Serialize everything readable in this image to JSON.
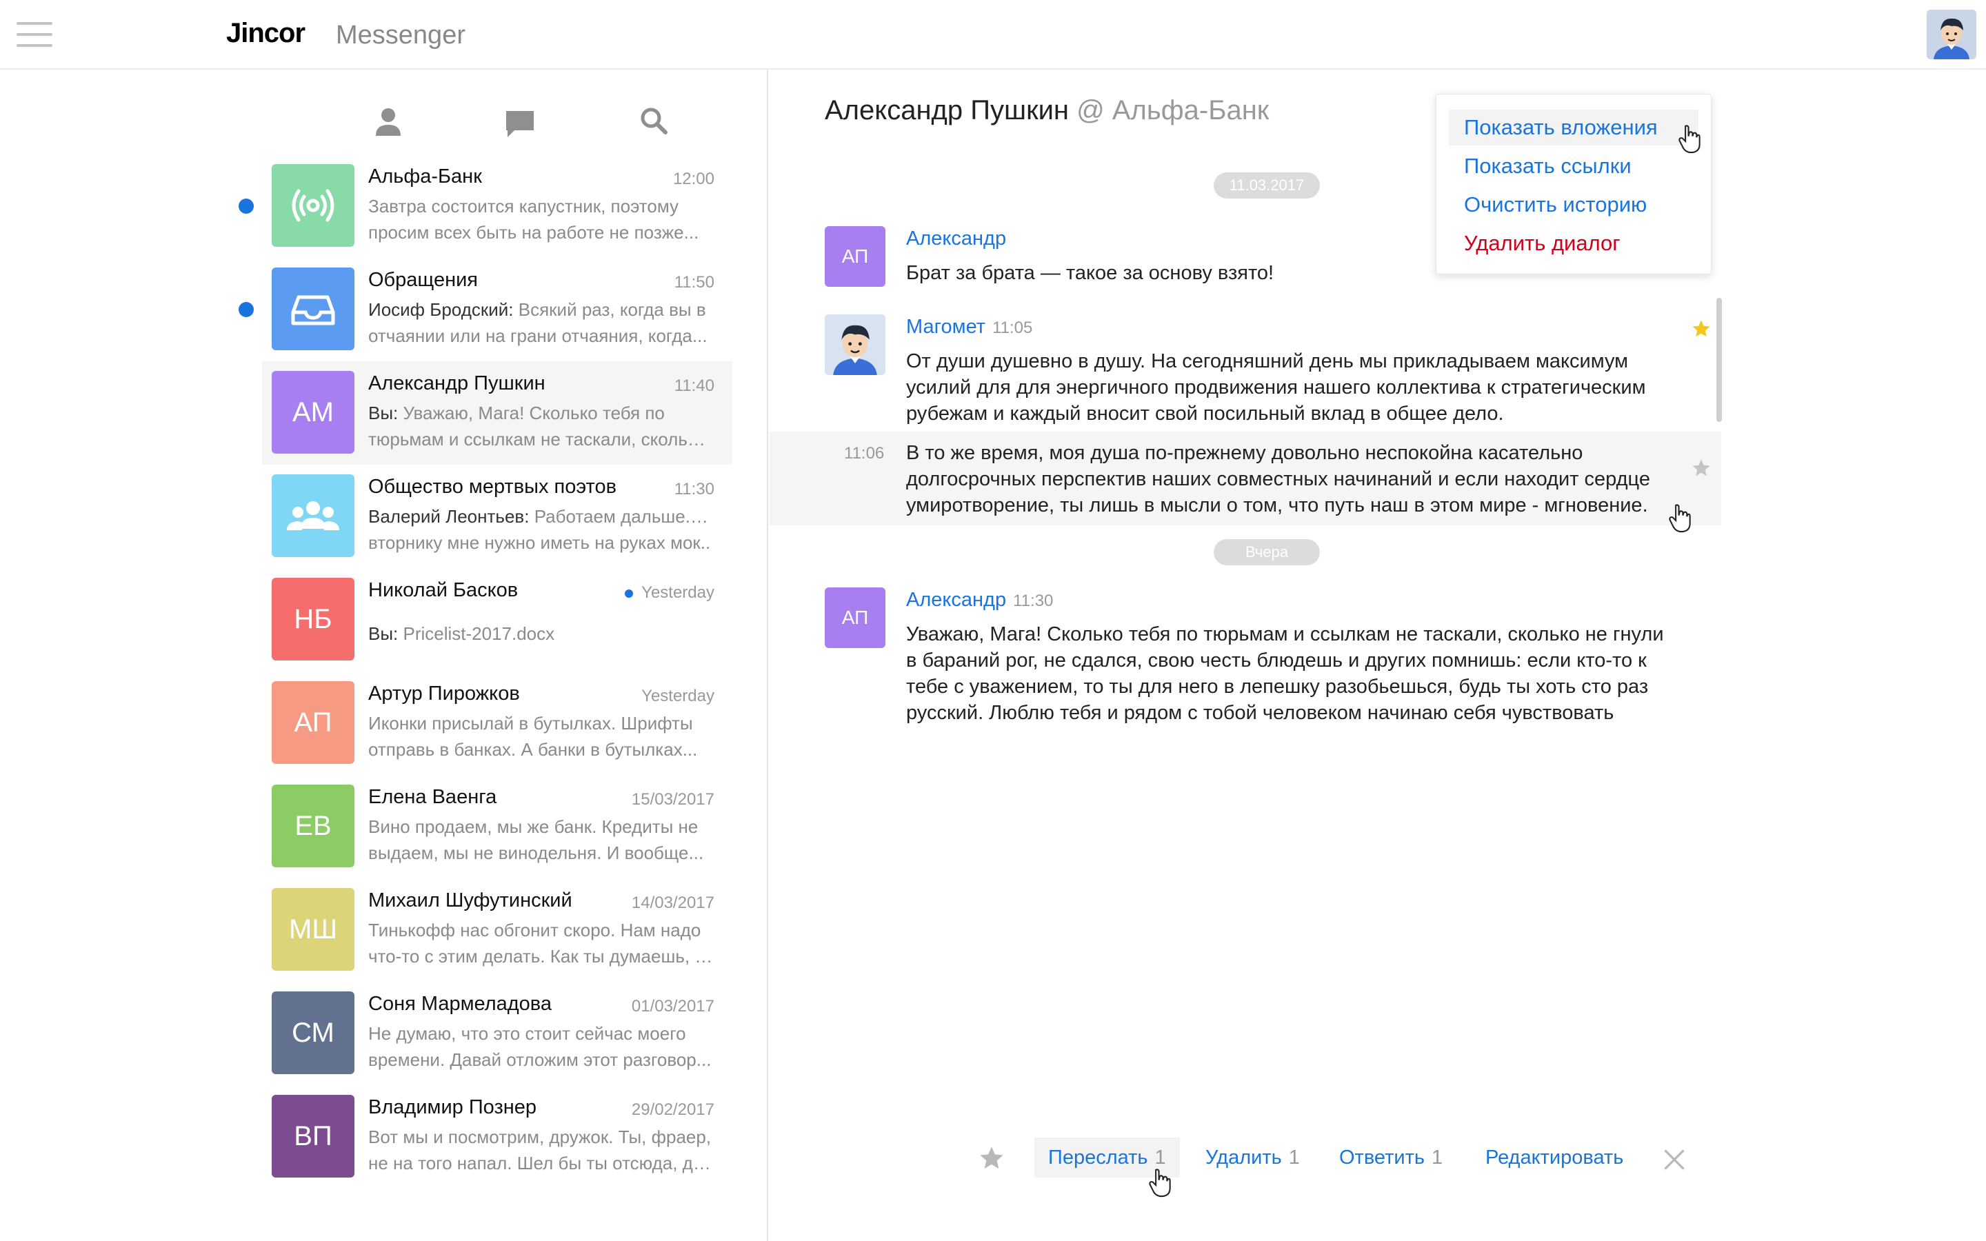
{
  "header": {
    "logo": "Jincor",
    "app_name": "Messenger"
  },
  "sidebar": {
    "tabs": [
      {
        "icon": "person-icon"
      },
      {
        "icon": "chat-bubble-icon"
      },
      {
        "icon": "search-icon"
      }
    ],
    "contacts": [
      {
        "name": "Альфа-Банк",
        "time": "12:00",
        "unread": true,
        "avatar_icon": "broadcast-icon",
        "avatar_color": "#88dba9",
        "sender": "",
        "preview": [
          "Завтра состоится капустник, поэтому",
          "просим всех быть на работе не позже..."
        ]
      },
      {
        "name": "Обращения",
        "time": "11:50",
        "unread": true,
        "avatar_icon": "inbox-icon",
        "avatar_color": "#5b9cf2",
        "sender": "Иосиф Бродский:",
        "preview": [
          "Всякий раз, когда вы в",
          "отчаянии или на грани отчаяния, когда..."
        ]
      },
      {
        "name": "Александр Пушкин",
        "time": "11:40",
        "active": true,
        "avatar_text": "АМ",
        "avatar_color": "#a77ff0",
        "sender": "Вы:",
        "preview": [
          "Уважаю, Мага! Сколько тебя по",
          "тюрьмам и ссылкам не таскали, сколько..."
        ]
      },
      {
        "name": "Общество мертвых поэтов",
        "time": "11:30",
        "avatar_icon": "group-icon",
        "avatar_color": "#80d7f5",
        "sender": "Валерий Леонтьев:",
        "preview": [
          "Работаем дальше. Ко",
          "вторнику мне нужно иметь на руках мок.."
        ]
      },
      {
        "name": "Николай Басков",
        "time": "Yesterday",
        "time_dot": true,
        "avatar_text": "НБ",
        "avatar_color": "#f56d6d",
        "sender": "Вы:",
        "preview": [
          "Pricelist-2017.docx"
        ]
      },
      {
        "name": "Артур Пирожков",
        "time": "Yesterday",
        "avatar_text": "АП",
        "avatar_color": "#f79a84",
        "sender": "",
        "preview": [
          "Иконки присылай в бутылках. Шрифты",
          "отправь в банках. А банки в бутылках..."
        ]
      },
      {
        "name": "Елена Ваенга",
        "time": "15/03/2017",
        "avatar_text": "ЕВ",
        "avatar_color": "#8ccc64",
        "sender": "",
        "preview": [
          "Вино продаем, мы же банк. Кредиты не",
          "выдаем, мы не винодельня. И вообще..."
        ]
      },
      {
        "name": "Михаил Шуфутинский",
        "time": "14/03/2017",
        "avatar_text": "МШ",
        "avatar_color": "#dcd478",
        "sender": "",
        "preview": [
          "Тинькофф нас обгонит скоро. Нам надо",
          "что-то с этим делать. Как ты думаешь, к..."
        ]
      },
      {
        "name": "Соня Мармеладова",
        "time": "01/03/2017",
        "avatar_text": "СМ",
        "avatar_color": "#62718e",
        "sender": "",
        "preview": [
          "Не думаю, что это стоит сейчас моего",
          "времени. Давай отложим этот разговор..."
        ]
      },
      {
        "name": "Владимир Познер",
        "time": "29/02/2017",
        "avatar_text": "ВП",
        "avatar_color": "#7d4b8f",
        "sender": "",
        "preview": [
          "Вот мы и посмотрим, дружок. Ты, фраер,",
          "не на того напал. Шел бы ты отсюда, да..."
        ]
      }
    ]
  },
  "chat": {
    "title": "Александр Пушкин",
    "org": "@ Альфа-Банк",
    "date_pill_1": "11.03.2017",
    "date_pill_2": "Вчера",
    "messages": [
      {
        "avatar_text": "АП",
        "author": "Александр",
        "time": "",
        "lines": [
          "Брат за брата — такое за основу взято!"
        ]
      },
      {
        "avatar_icon": "user-face-icon",
        "author": "Магомет",
        "time": "11:05",
        "starred": true,
        "lines": [
          "От души душевно в душу. На сегодняшний день мы прикладываем максимум",
          "усилий для для энергичного продвижения нашего коллектива к стратегическим",
          "рубежам и каждый вносит свой посильный вклад в общее дело."
        ]
      },
      {
        "time": "11:06",
        "starred": false,
        "lines": [
          "В то же время, моя душа по-прежнему довольно неспокойна касательно",
          "долгосрочных перспектив наших совместных начинаний и если находит сердце",
          "умиротворение, ты лишь в мысли о том, что путь наш в этом мире - мгновение."
        ]
      },
      {
        "avatar_text": "АП",
        "author": "Александр",
        "time": "11:30",
        "lines": [
          "Уважаю, Мага! Сколько тебя по тюрьмам и ссылкам не таскали, сколько не гнули",
          "в бараний рог, не сдался, свою честь блюдешь и других помнишь: если кто-то к",
          "тебе с уважением, то ты для него в лепешку разобьешься, будь ты хоть сто раз",
          "русский. Люблю тебя и рядом с тобой человеком начинаю себя чувствовать"
        ]
      }
    ]
  },
  "menu": {
    "items": [
      "Показать вложения",
      "Показать ссылки",
      "Очистить историю",
      "Удалить диалог"
    ]
  },
  "actions": {
    "forward": "Переслать",
    "forward_count": "1",
    "delete": "Удалить",
    "delete_count": "1",
    "reply": "Ответить",
    "reply_count": "1",
    "edit": "Редактировать"
  },
  "colors": {
    "accent": "#1a74dd",
    "danger": "#d0021b",
    "star_active": "#f5c518",
    "star_inactive": "#c4c4c4"
  }
}
